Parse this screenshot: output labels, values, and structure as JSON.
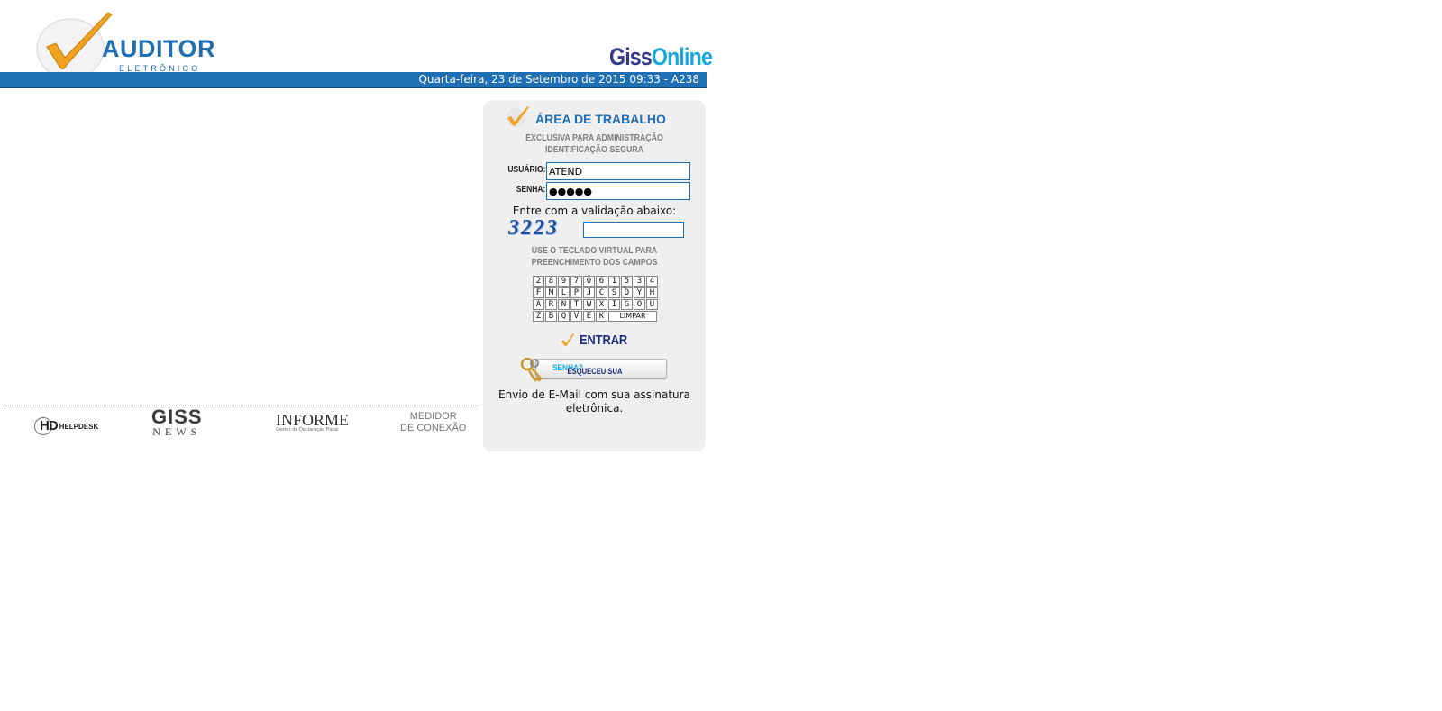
{
  "header": {
    "logo_title": "AUDITOR",
    "logo_subtitle": "ELETRÔNICO",
    "brand_part1": "Giss",
    "brand_part2": "Online",
    "date_text": "Quarta-feira, 23 de Setembro de 2015 09:33 - A238"
  },
  "footer_logos": {
    "helpdesk_mark": "HD",
    "helpdesk_text": "HELPDESK",
    "gissnews_top": "GISS",
    "gissnews_bottom": "NEWS",
    "informe_title": "INFORME",
    "informe_sub": "Gestor de Declaração Fiscal",
    "medidor_top": "MEDIDOR",
    "medidor_bottom": "DE CONEXÃO"
  },
  "login": {
    "title": "ÁREA DE TRABALHO",
    "subtitle_line1": "EXCLUSIVA PARA ADMINISTRAÇÃO",
    "subtitle_line2": "IDENTIFICAÇÃO SEGURA",
    "user_label": "USUÁRIO:",
    "user_value": "ATEND",
    "pass_label": "SENHA:",
    "pass_value": "●●●●●",
    "captcha_label": "Entre com a validação abaixo:",
    "captcha_code": "3223",
    "captcha_value": "",
    "keyboard_hint_line1": "USE O TECLADO VIRTUAL PARA",
    "keyboard_hint_line2": "PREENCHIMENTO DOS CAMPOS",
    "keyboard_rows": [
      [
        "2",
        "8",
        "9",
        "7",
        "0",
        "6",
        "1",
        "5",
        "3",
        "4"
      ],
      [
        "F",
        "M",
        "L",
        "P",
        "J",
        "C",
        "S",
        "D",
        "Y",
        "H"
      ],
      [
        "A",
        "R",
        "N",
        "T",
        "W",
        "X",
        "I",
        "G",
        "O",
        "U"
      ],
      [
        "Z",
        "B",
        "Q",
        "V",
        "E",
        "K",
        "LIMPAR"
      ]
    ],
    "enter_label": "ENTRAR",
    "forgot_label_part1": "ESQUECEU SUA ",
    "forgot_label_part2": "SENHA?",
    "email_note": "Envio de E-Mail com sua assinatura eletrônica."
  },
  "colors": {
    "brand_blue": "#1f6fb5",
    "check_orange": "#f0a320",
    "panel_bg": "#efefef"
  }
}
